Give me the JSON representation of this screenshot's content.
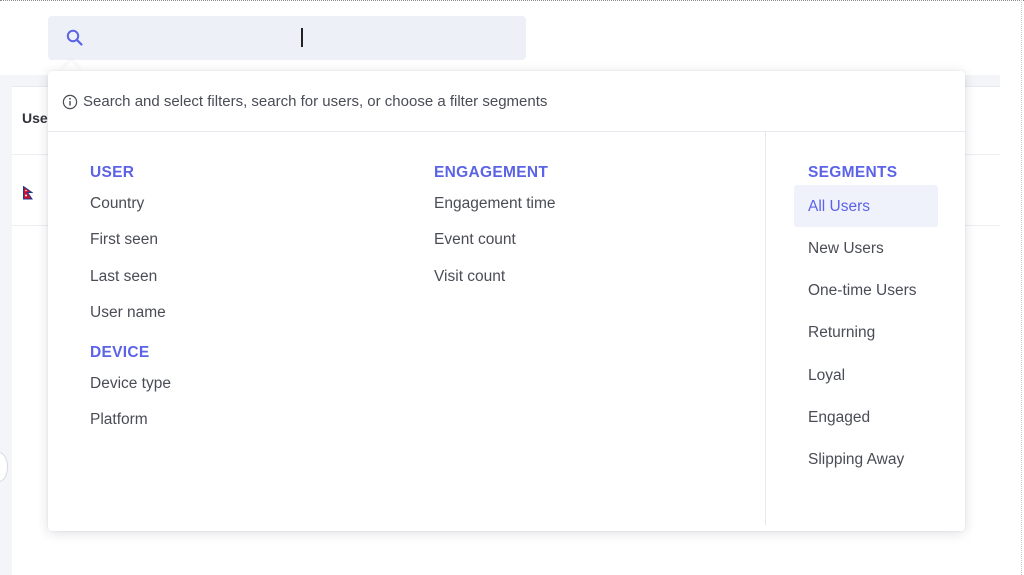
{
  "search": {
    "placeholder": "",
    "value": ""
  },
  "hint": {
    "text": "Search and select filters, search for users, or choose a filter segments"
  },
  "background": {
    "header_cell": "User"
  },
  "sections": {
    "user": {
      "title": "USER",
      "items": [
        "Country",
        "First seen",
        "Last seen",
        "User name"
      ]
    },
    "device": {
      "title": "DEVICE",
      "items": [
        "Device type",
        "Platform"
      ]
    },
    "engagement": {
      "title": "ENGAGEMENT",
      "items": [
        "Engagement time",
        "Event count",
        "Visit count"
      ]
    },
    "segments": {
      "title": "SEGMENTS",
      "selected": "All Users",
      "items": [
        "All Users",
        "New Users",
        "One-time Users",
        "Returning",
        "Loyal",
        "Engaged",
        "Slipping Away"
      ]
    }
  },
  "colors": {
    "accent": "#5b63e6",
    "text": "#4a4c56",
    "search_bg": "#eef0f8"
  }
}
